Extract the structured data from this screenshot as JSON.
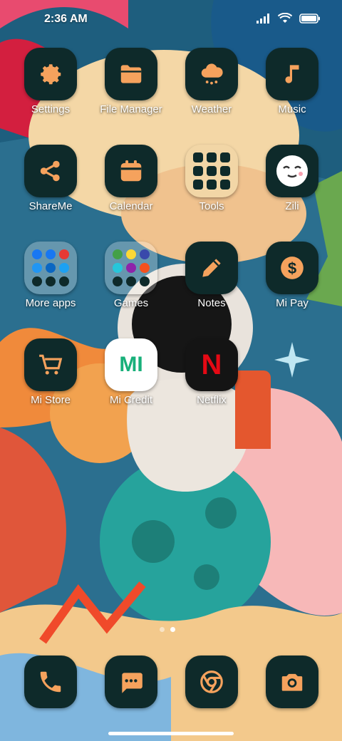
{
  "status": {
    "time": "2:36 AM"
  },
  "apps": [
    {
      "id": "settings",
      "label": "Settings",
      "icon": "gear-icon"
    },
    {
      "id": "file-manager",
      "label": "File Manager",
      "icon": "folder-icon"
    },
    {
      "id": "weather",
      "label": "Weather",
      "icon": "cloud-rain-icon"
    },
    {
      "id": "music",
      "label": "Music",
      "icon": "music-note-icon"
    },
    {
      "id": "shareme",
      "label": "ShareMe",
      "icon": "share-icon"
    },
    {
      "id": "calendar",
      "label": "Calendar",
      "icon": "calendar-icon"
    },
    {
      "id": "tools",
      "label": "Tools",
      "icon": "folder-grid-icon"
    },
    {
      "id": "zili",
      "label": "Zili",
      "icon": "smiley-face-icon"
    },
    {
      "id": "more-apps",
      "label": "More apps",
      "icon": "folder-grid-icon"
    },
    {
      "id": "games",
      "label": "Games",
      "icon": "folder-grid-icon"
    },
    {
      "id": "notes",
      "label": "Notes",
      "icon": "pencil-icon"
    },
    {
      "id": "mi-pay",
      "label": "Mi Pay",
      "icon": "dollar-coin-icon"
    },
    {
      "id": "mi-store",
      "label": "Mi Store",
      "icon": "shopping-cart-icon"
    },
    {
      "id": "mi-credit",
      "label": "Mi Credit",
      "icon": "mi-credit-logo-icon",
      "logo_text": "MI"
    },
    {
      "id": "netflix",
      "label": "Netflix",
      "icon": "netflix-logo-icon",
      "logo_text": "N"
    }
  ],
  "dock": [
    {
      "id": "phone",
      "icon": "phone-icon"
    },
    {
      "id": "messages",
      "icon": "message-icon"
    },
    {
      "id": "chrome",
      "icon": "chrome-icon"
    },
    {
      "id": "camera",
      "icon": "camera-icon"
    }
  ],
  "colors": {
    "accent": "#f5a25d",
    "tile": "#0e2a2a"
  }
}
